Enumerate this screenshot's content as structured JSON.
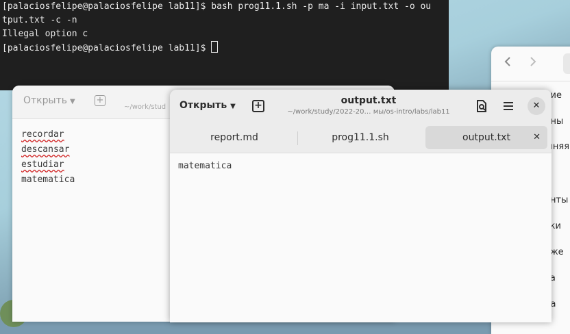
{
  "terminal": {
    "lines": [
      "[palaciosfelipe@palaciosfelipe lab11]$ bash prog11.1.sh -p ma -i input.txt -o ou",
      "tput.txt -c -n",
      "Illegal option c",
      "[palaciosfelipe@palaciosfelipe lab11]$ "
    ]
  },
  "right_window": {
    "back_icon": "chevron-left-icon",
    "forward_icon": "chevron-right-icon",
    "items": [
      "ние",
      "нны",
      "шняя",
      "енты",
      "вки",
      "аже",
      "ка",
      "на"
    ]
  },
  "back_editor": {
    "open_label": "Открыть",
    "subtitle": "~/work/stud",
    "lines": [
      "recordar",
      "descansar",
      "estudiar",
      "matematica"
    ]
  },
  "front_editor": {
    "open_label": "Открыть",
    "title": "output.txt",
    "subtitle": "~/work/study/2022-20…  мы/os-intro/labs/lab11",
    "tabs": [
      {
        "label": "report.md",
        "active": false
      },
      {
        "label": "prog11.1.sh",
        "active": false
      },
      {
        "label": "output.txt",
        "active": true
      }
    ],
    "content": "matematica"
  }
}
